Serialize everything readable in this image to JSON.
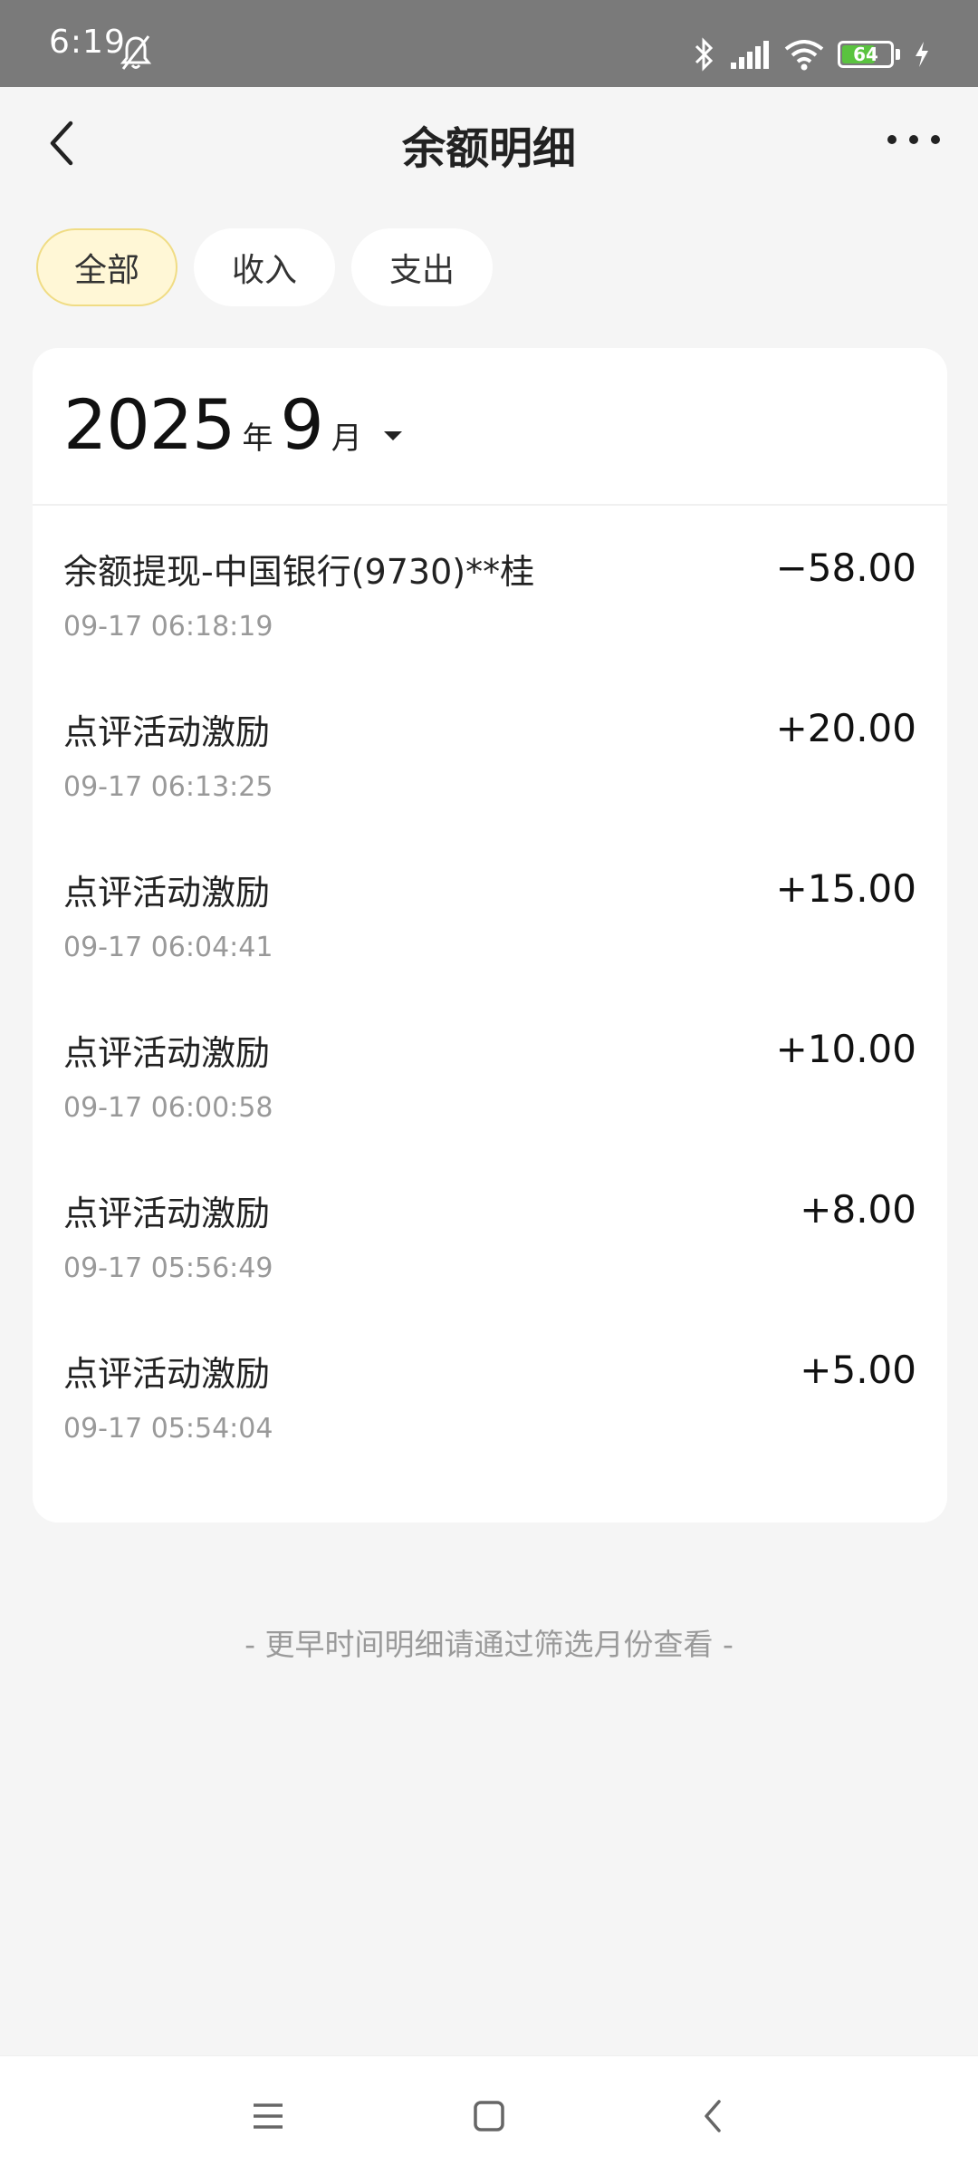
{
  "status_bar": {
    "time": "6:19",
    "battery": "64",
    "battery_level": 0.64,
    "battery_fill_color": "#5ac33f",
    "icons": [
      "bell-off-icon",
      "bluetooth-icon",
      "signal-icon",
      "wifi-icon",
      "battery-icon",
      "charging-icon"
    ]
  },
  "header": {
    "title": "余额明细",
    "back_icon": "chevron-left-icon",
    "more_icon": "more-horizontal-icon"
  },
  "filters": [
    {
      "label": "全部",
      "active": true
    },
    {
      "label": "收入",
      "active": false
    },
    {
      "label": "支出",
      "active": false
    }
  ],
  "month_picker": {
    "year": "2025",
    "year_unit": "年",
    "month": "9",
    "month_unit": "月",
    "caret_icon": "caret-down-icon"
  },
  "transactions": [
    {
      "title": "余额提现-中国银行(9730)**桂",
      "time": "09-17 06:18:19",
      "amount": "−58.00"
    },
    {
      "title": "点评活动激励",
      "time": "09-17 06:13:25",
      "amount": "+20.00"
    },
    {
      "title": "点评活动激励",
      "time": "09-17 06:04:41",
      "amount": "+15.00"
    },
    {
      "title": "点评活动激励",
      "time": "09-17 06:00:58",
      "amount": "+10.00"
    },
    {
      "title": "点评活动激励",
      "time": "09-17 05:56:49",
      "amount": "+8.00"
    },
    {
      "title": "点评活动激励",
      "time": "09-17 05:54:04",
      "amount": "+5.00"
    }
  ],
  "footer_note": "- 更早时间明细请通过筛选月份查看 -",
  "nav_bar": {
    "icons": [
      "menu-icon",
      "home-square-icon",
      "back-triangle-icon"
    ]
  },
  "colors": {
    "accent_chip_bg": "#fff7d6",
    "accent_chip_border": "#f0dc84",
    "page_bg": "#f5f5f5",
    "status_bar_bg": "#7a7a7a"
  }
}
